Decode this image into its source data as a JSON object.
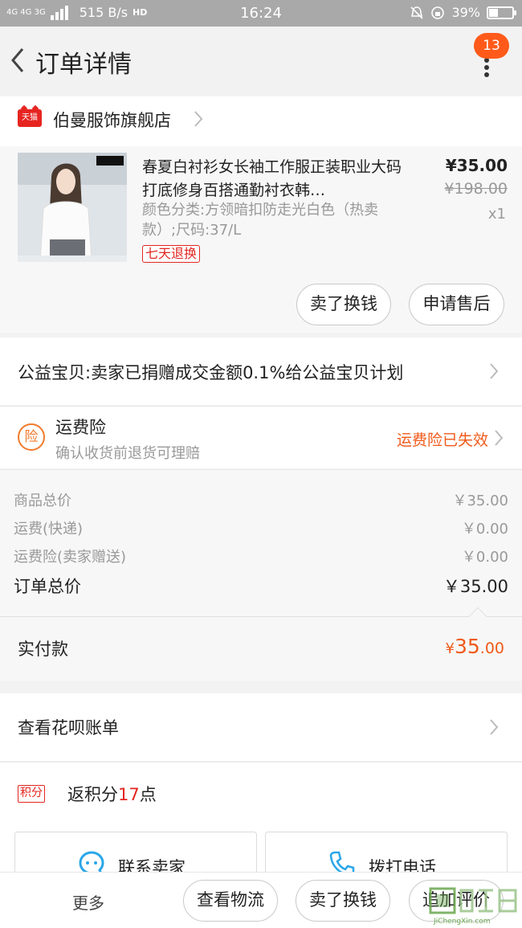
{
  "status_bar": {
    "network": "4G 4G 3G",
    "speed": "515 B/s",
    "hd": "HD",
    "time": "16:24",
    "battery": "39%",
    "battery_level": 0.39
  },
  "header": {
    "title": "订单详情",
    "notification_count": "13"
  },
  "store": {
    "badge": "天猫",
    "name": "伯曼服饰旗舰店"
  },
  "product": {
    "title": "春夏白衬衫女长袖工作服正装职业大码打底修身百搭通勤衬衣韩…",
    "variant": "颜色分类:方领暗扣防走光白色（热卖款）;尺码:37/L",
    "badge": "七天退换",
    "price": "¥35.00",
    "original_price": "¥198.00",
    "quantity": "x1",
    "sell_button": "卖了换钱",
    "aftersale_button": "申请售后"
  },
  "charity": {
    "text": "公益宝贝:卖家已捐赠成交金额0.1%给公益宝贝计划"
  },
  "insurance": {
    "icon_text": "险",
    "title": "运费险",
    "subtitle": "确认收货前退货可理赔",
    "status": "运费险已失效"
  },
  "summary": {
    "rows": [
      {
        "label": "商品总价",
        "value": "￥35.00"
      },
      {
        "label": "运费(快递)",
        "value": "￥0.00"
      },
      {
        "label": "运费险(卖家赠送)",
        "value": "￥0.00"
      }
    ],
    "total_label": "订单总价",
    "total_value": "￥35.00"
  },
  "payment": {
    "label": "实付款",
    "currency": "¥",
    "amount_int": "35",
    "amount_dec": ".00"
  },
  "huabei": {
    "text": "查看花呗账单"
  },
  "points": {
    "badge": "积分",
    "prefix": "返积分",
    "count": "17",
    "suffix": "点"
  },
  "contact": {
    "seller": "联系卖家",
    "phone": "拨打电话"
  },
  "bottom_bar": {
    "more": "更多",
    "logistics": "查看物流",
    "sell": "卖了换钱",
    "review": "追加评价"
  },
  "watermark": "JiChengXin.com",
  "colors": {
    "accent_orange": "#f05a1a",
    "tmall_red": "#e62521",
    "badge_orange": "#ff5a1a"
  }
}
